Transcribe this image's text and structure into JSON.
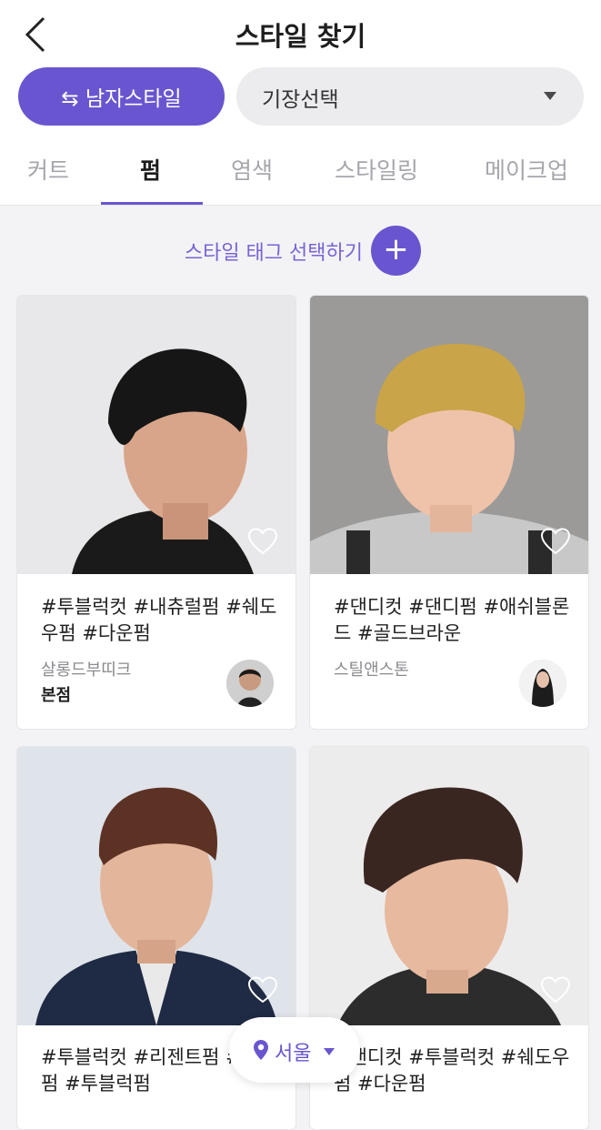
{
  "header": {
    "title": "스타일 찾기",
    "gender_button": "⇆ 남자스타일",
    "length_select": "기장선택"
  },
  "tabs": [
    {
      "label": "커트"
    },
    {
      "label": "펌",
      "active": true
    },
    {
      "label": "염색"
    },
    {
      "label": "스타일링"
    },
    {
      "label": "메이크업"
    }
  ],
  "tag_select": {
    "label": "스타일 태그 선택하기",
    "button": "+"
  },
  "cards": [
    {
      "tags": "#투블럭컷 #내츄럴펌 #쉐도우펌 #다운펌",
      "salon": "살롱드부띠크",
      "branch": "본점",
      "liked": false
    },
    {
      "tags": "#댄디컷 #댄디펌 #애쉬블론드 #골드브라운",
      "salon": "스틸앤스톤",
      "branch": "",
      "liked": false
    },
    {
      "tags": "#투블럭컷 #리젠트펌 #볼륨펌 #투블럭펌",
      "liked": false
    },
    {
      "tags": "#댄디컷 #투블럭컷 #쉐도우펌 #다운펌",
      "liked": false
    }
  ],
  "location": {
    "label": "서울"
  },
  "colors": {
    "accent": "#6a55d0",
    "tab_inactive": "#a6a6ad"
  },
  "icons": [
    "back-arrow-icon",
    "swap-icon",
    "dropdown-caret-icon",
    "plus-icon",
    "heart-icon",
    "location-pin-icon",
    "caret-down-icon"
  ]
}
